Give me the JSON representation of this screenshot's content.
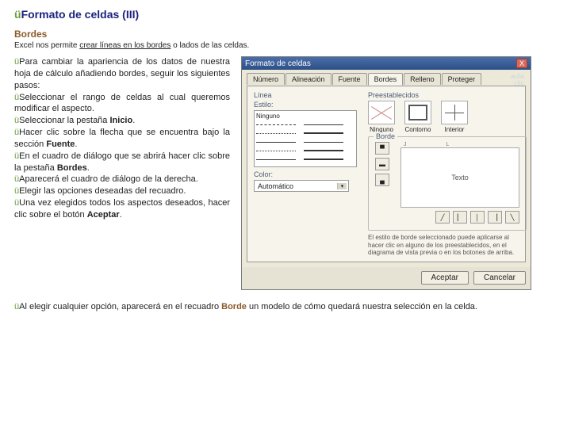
{
  "title": {
    "check": "ü",
    "text": "Formato de celdas (III)"
  },
  "section": "Bordes",
  "intro": {
    "pre": "Excel nos permite ",
    "u": "crear líneas en los bordes",
    "post": " o lados de las celdas."
  },
  "bullets": [
    {
      "pre": "Para cambiar la apariencia de los datos de nuestra hoja de cálculo añadiendo bordes, seguir los siguientes pasos:"
    },
    {
      "pre": "Seleccionar el rango de celdas al cual queremos modificar el aspecto."
    },
    {
      "pre": "Seleccionar la pestaña ",
      "b": "Inicio",
      "post": "."
    },
    {
      "pre": "Hacer clic sobre la flecha que se encuentra bajo la sección ",
      "b": "Fuente",
      "post": "."
    },
    {
      "pre": "En el cuadro de diálogo que se abrirá hacer clic sobre la pestaña ",
      "b": "Bordes",
      "post": "."
    },
    {
      "pre": "Aparecerá el cuadro de diálogo de la derecha."
    },
    {
      "pre": "Elegir las opciones deseadas del recuadro."
    },
    {
      "pre": "Una vez elegidos todos los aspectos deseados, hacer clic sobre el botón ",
      "b": "Aceptar",
      "post": "."
    }
  ],
  "dialog": {
    "title": "Formato de celdas",
    "close": "X",
    "watermark1": "aula",
    "watermark2": "clic",
    "tabs": [
      "Número",
      "Alineación",
      "Fuente",
      "Bordes",
      "Relleno",
      "Proteger"
    ],
    "activeTab": "Bordes",
    "lineLabel": "Línea",
    "styleLabel": "Estilo:",
    "none": "Ninguno",
    "colorLabel": "Color:",
    "colorValue": "Automático",
    "presetsLabel": "Preestablecidos",
    "presets": [
      "Ninguno",
      "Contorno",
      "Interior"
    ],
    "bordeLabel": "Borde",
    "previewText": "Texto",
    "edgeHoriz": [
      "J",
      "",
      "L"
    ],
    "hint": "El estilo de borde seleccionado puede aplicarse al hacer clic en alguno de los preestablecidos, en el diagrama de vista previa o en los botones de arriba.",
    "ok": "Aceptar",
    "cancel": "Cancelar"
  },
  "footer": {
    "check": "ü",
    "pre": "Al elegir cualquier opción, aparecerá en el recuadro ",
    "b": "Borde",
    "post": " un modelo de cómo quedará nuestra selección en la celda."
  }
}
